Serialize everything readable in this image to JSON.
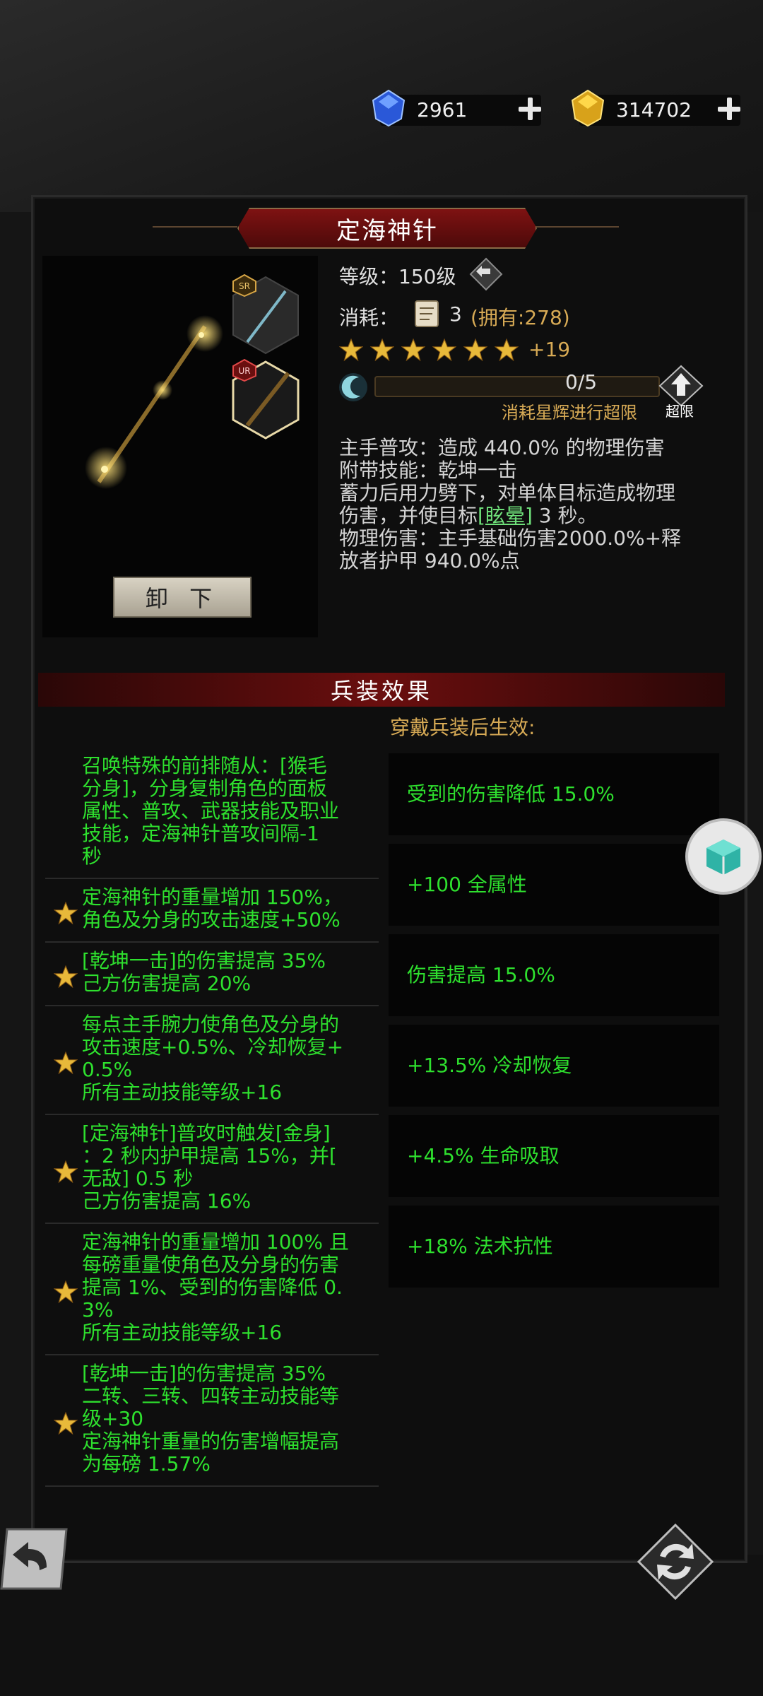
{
  "currency": {
    "gems": "2961",
    "gold": "314702"
  },
  "item": {
    "name": "定海神针",
    "slot_badge_1": "SR",
    "slot_badge_2": "UR",
    "unequip_label": "卸 下"
  },
  "stats": {
    "level_label": "等级：",
    "level_value": "150级",
    "cost_label": "消耗：",
    "cost_count": "3",
    "cost_owned": "(拥有:278)",
    "stars": 6,
    "star_bonus": "+19",
    "progress_text": "0/5",
    "progress_fraction": 0,
    "progress_hint": "消耗星辉进行超限",
    "limit_break_label": "超限"
  },
  "description": {
    "line1": "主手普攻：造成 440.0% 的物理伤害",
    "line2": "附带技能：乾坤一击",
    "line3": "蓄力后用力劈下，对单体目标造成物理",
    "line4_a": "伤害，并使目标",
    "line4_link": "[眩晕]",
    "line4_b": " 3 秒。",
    "line5": "物理伤害：主手基础伤害2000.0%+释",
    "line6": "放者护甲 940.0%点"
  },
  "effects_section": {
    "title": "兵装效果",
    "subtitle": "穿戴兵装后生效:"
  },
  "effects": [
    {
      "star": false,
      "lines": [
        "召唤特殊的前排随从：[猴毛",
        "分身]，分身复制角色的面板",
        "属性、普攻、武器技能及职业",
        "技能，定海神针普攻间隔-1",
        "秒"
      ]
    },
    {
      "star": true,
      "lines": [
        "定海神针的重量增加 150%，",
        "角色及分身的攻击速度+50%"
      ]
    },
    {
      "star": true,
      "lines": [
        "[乾坤一击]的伤害提高 35%",
        "己方伤害提高 20%"
      ]
    },
    {
      "star": true,
      "lines": [
        "每点主手腕力使角色及分身的",
        "攻击速度+0.5%、冷却恢复+",
        "0.5%",
        "所有主动技能等级+16"
      ]
    },
    {
      "star": true,
      "lines": [
        "[定海神针]普攻时触发[金身]",
        "：2 秒内护甲提高 15%，并[",
        "无敌] 0.5 秒",
        "己方伤害提高 16%"
      ]
    },
    {
      "star": true,
      "lines": [
        "定海神针的重量增加 100% 且",
        "每磅重量使角色及分身的伤害",
        "提高 1%、受到的伤害降低 0.",
        "3%",
        "所有主动技能等级+16"
      ]
    },
    {
      "star": true,
      "lines": [
        "[乾坤一击]的伤害提高 35%",
        "二转、三转、四转主动技能等",
        "级+30",
        "定海神针重量的伤害增幅提高",
        "为每磅 1.57%"
      ]
    }
  ],
  "bonus_stats": [
    "受到的伤害降低 15.0%",
    "+100 全属性",
    "伤害提高 15.0%",
    "+13.5% 冷却恢复",
    "+4.5% 生命吸取",
    "+18% 法术抗性"
  ],
  "colors": {
    "effect_text": "#2ee02e",
    "gold_text": "#d7aa55",
    "title_red": "#7e1212"
  }
}
